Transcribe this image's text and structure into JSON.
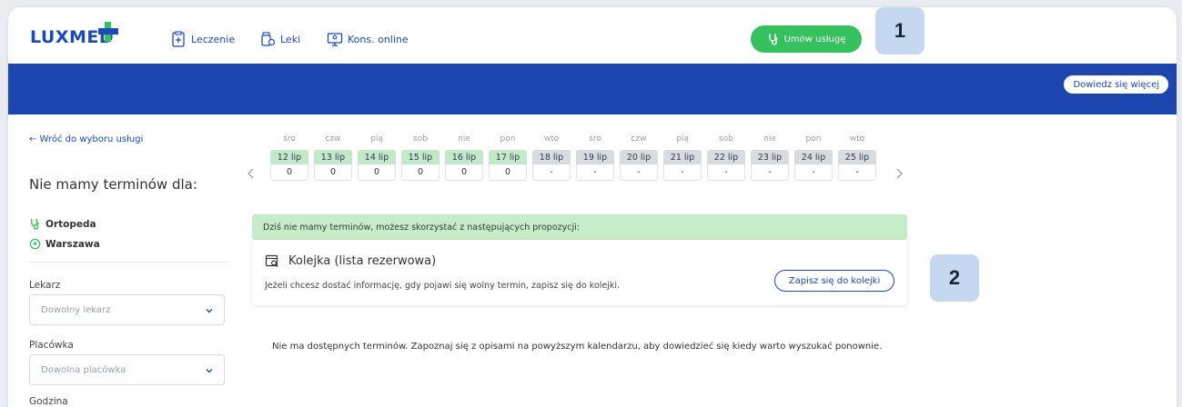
{
  "header": {
    "logo_text": "LUXMED",
    "nav": [
      {
        "label": "Leczenie",
        "icon": "clipboard-icon"
      },
      {
        "label": "Leki",
        "icon": "pills-icon"
      },
      {
        "label": "Kons. online",
        "icon": "monitor-icon"
      }
    ],
    "cta_label": "Umów usługę",
    "cta_icon": "stethoscope-icon"
  },
  "banner": {
    "learn_more": "Dowiedz się więcej"
  },
  "annotations": {
    "badge1": "1",
    "badge2": "2"
  },
  "sidebar": {
    "back_link": "← Wróć do wyboru usługi",
    "heading": "Nie mamy terminów dla:",
    "specialty": "Ortopeda",
    "city": "Warszawa",
    "doctor_label": "Lekarz",
    "doctor_placeholder": "Dowolny lekarz",
    "facility_label": "Placówka",
    "facility_placeholder": "Dowolna placówka",
    "time_label": "Godzina"
  },
  "calendar": {
    "days": [
      {
        "dow": "śro",
        "date": "12 lip",
        "count": "0",
        "available": true
      },
      {
        "dow": "czw",
        "date": "13 lip",
        "count": "0",
        "available": true
      },
      {
        "dow": "pią",
        "date": "14 lip",
        "count": "0",
        "available": true
      },
      {
        "dow": "sob",
        "date": "15 lip",
        "count": "0",
        "available": true
      },
      {
        "dow": "nie",
        "date": "16 lip",
        "count": "0",
        "available": true
      },
      {
        "dow": "pon",
        "date": "17 lip",
        "count": "0",
        "available": true
      },
      {
        "dow": "wto",
        "date": "18 lip",
        "count": "-",
        "available": false
      },
      {
        "dow": "śro",
        "date": "19 lip",
        "count": "-",
        "available": false
      },
      {
        "dow": "czw",
        "date": "20 lip",
        "count": "-",
        "available": false
      },
      {
        "dow": "pią",
        "date": "21 lip",
        "count": "-",
        "available": false
      },
      {
        "dow": "sob",
        "date": "22 lip",
        "count": "-",
        "available": false
      },
      {
        "dow": "nie",
        "date": "23 lip",
        "count": "-",
        "available": false
      },
      {
        "dow": "pon",
        "date": "24 lip",
        "count": "-",
        "available": false
      },
      {
        "dow": "wto",
        "date": "25 lip",
        "count": "-",
        "available": false
      }
    ]
  },
  "main": {
    "info_bar": "Dziś nie mamy terminów, możesz skorzystać z następujących propozycji:",
    "queue_title": "Kolejka (lista rezerwowa)",
    "queue_desc": "Jeżeli chcesz dostać informację, gdy pojawi się wolny termin, zapisz się do kolejki.",
    "queue_button": "Zapisz się do kolejki",
    "bottom_note": "Nie ma dostępnych terminów. Zapoznaj się z opisami na powyższym kalendarzu, aby dowiedzieć się kiedy warto wyszukać ponownie."
  },
  "colors": {
    "brand_blue": "#1c46ad",
    "cta_green": "#35c15d",
    "available_green": "#c2e9c9",
    "unavailable_grey": "#d8dce1",
    "badge_bg": "#c6d8f0"
  }
}
